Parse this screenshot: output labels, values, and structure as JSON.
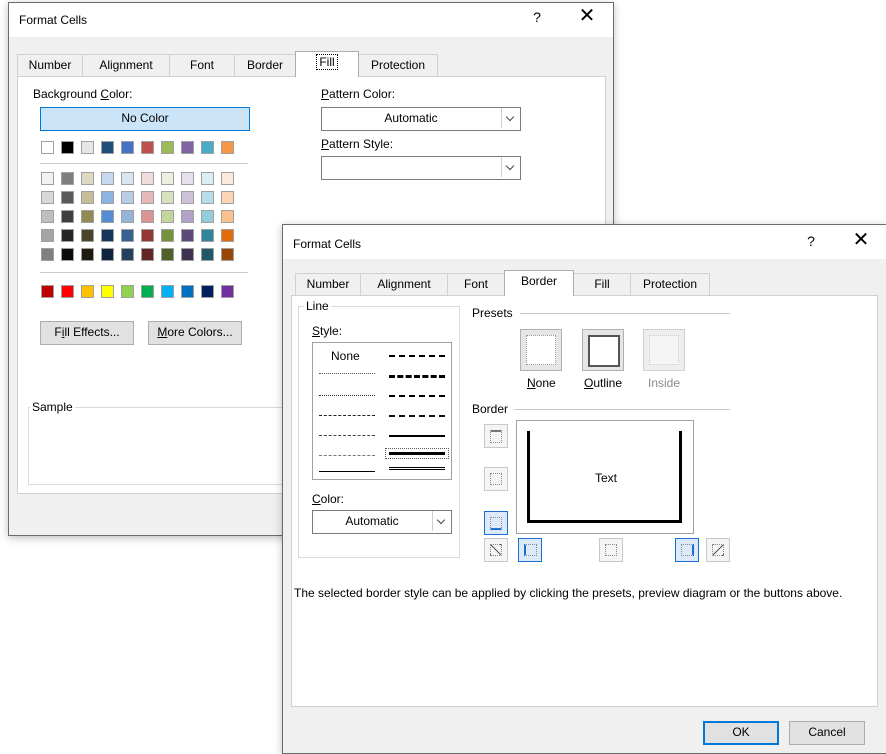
{
  "back": {
    "title": "Format Cells",
    "help": "?",
    "close": "✕",
    "tabs": [
      "Number",
      "Alignment",
      "Font",
      "Border",
      "Fill",
      "Protection"
    ],
    "selected_tab": "Fill",
    "background_color_label": "Background Color:",
    "no_color_label": "No Color",
    "pattern_color_label": "Pattern Color:",
    "pattern_color_value": "Automatic",
    "pattern_style_label": "Pattern Style:",
    "pattern_style_value": "",
    "fill_effects_label": "Fill Effects...",
    "more_colors_label": "More Colors...",
    "sample_label": "Sample",
    "theme_colors": [
      [
        "#ffffff",
        "#000000",
        "#e7e6e6",
        "#44546a",
        "#4472c4",
        "#ed7d31",
        "#a5a5a5",
        "#ffc000",
        "#5b9bd5",
        "#70ad47"
      ],
      [
        "#f2f2f2",
        "#7f7f7f",
        "#d0cece",
        "#d6dce4",
        "#d9e2f3",
        "#fbe5d5",
        "#ededed",
        "#fff2cc",
        "#deebf6",
        "#e2efd9"
      ],
      [
        "#d8d8d8",
        "#595959",
        "#aeabab",
        "#adb9ca",
        "#b4c6e7",
        "#f7caac",
        "#dbdbdb",
        "#fee599",
        "#bdd7ee",
        "#c5e0b3"
      ],
      [
        "#bfbfbf",
        "#3f3f3f",
        "#757070",
        "#8496b0",
        "#8eaadb",
        "#f4b183",
        "#c9c9c9",
        "#ffd965",
        "#9cc3e5",
        "#a8d08d"
      ],
      [
        "#a5a5a5",
        "#262626",
        "#3a3838",
        "#323f4f",
        "#2f5496",
        "#c55a11",
        "#7b7b7b",
        "#bf9000",
        "#2e75b5",
        "#538135"
      ],
      [
        "#7f7f7f",
        "#0c0c0c",
        "#171616",
        "#222a35",
        "#1f3864",
        "#833c0b",
        "#525252",
        "#7f6000",
        "#1e4e79",
        "#375623"
      ]
    ],
    "theme_colors_display": [
      [
        "#ffffff",
        "#000000",
        "#e7e6e6",
        "#1f4e79",
        "#4472c4",
        "#c0504d",
        "#9bbb59",
        "#8064a2",
        "#4bacc6",
        "#f79646"
      ],
      [
        "#f2f2f2",
        "#7f7f7f",
        "#ddd9c3",
        "#c6d9f0",
        "#dbe5f1",
        "#f2dcdb",
        "#ebf1dd",
        "#e5e0ec",
        "#dbeef3",
        "#fdeada"
      ],
      [
        "#d8d8d8",
        "#595959",
        "#c4bd97",
        "#8db3e2",
        "#b8cce4",
        "#e5b9b7",
        "#d7e3bc",
        "#ccc1d9",
        "#b7dde8",
        "#fbd5b5"
      ],
      [
        "#bfbfbf",
        "#3f3f3f",
        "#938953",
        "#548dd4",
        "#95b3d7",
        "#d99694",
        "#c3d69b",
        "#b2a2c7",
        "#92cddc",
        "#fac08f"
      ],
      [
        "#a5a5a5",
        "#262626",
        "#494429",
        "#17365d",
        "#366092",
        "#953734",
        "#76923c",
        "#5f497a",
        "#31859b",
        "#e36c09"
      ],
      [
        "#7f7f7f",
        "#0c0c0c",
        "#1d1b10",
        "#0f243e",
        "#244061",
        "#632423",
        "#4f6128",
        "#3f3151",
        "#205867",
        "#974806"
      ]
    ],
    "standard_colors": [
      "#c00000",
      "#ff0000",
      "#ffc000",
      "#ffff00",
      "#92d050",
      "#00b050",
      "#00b0f0",
      "#0070c0",
      "#002060",
      "#7030a0"
    ]
  },
  "front": {
    "title": "Format Cells",
    "help": "?",
    "close": "✕",
    "tabs": [
      "Number",
      "Alignment",
      "Font",
      "Border",
      "Fill",
      "Protection"
    ],
    "selected_tab": "Border",
    "line_group": "Line",
    "style_label": "Style:",
    "none_label": "None",
    "color_label": "Color:",
    "color_value": "Automatic",
    "presets_group": "Presets",
    "preset_none": "None",
    "preset_outline": "Outline",
    "preset_inside": "Inside",
    "border_group": "Border",
    "preview_text": "Text",
    "hint": "The selected border style can be applied by clicking the presets, preview diagram or the buttons above.",
    "ok_label": "OK",
    "cancel_label": "Cancel"
  }
}
